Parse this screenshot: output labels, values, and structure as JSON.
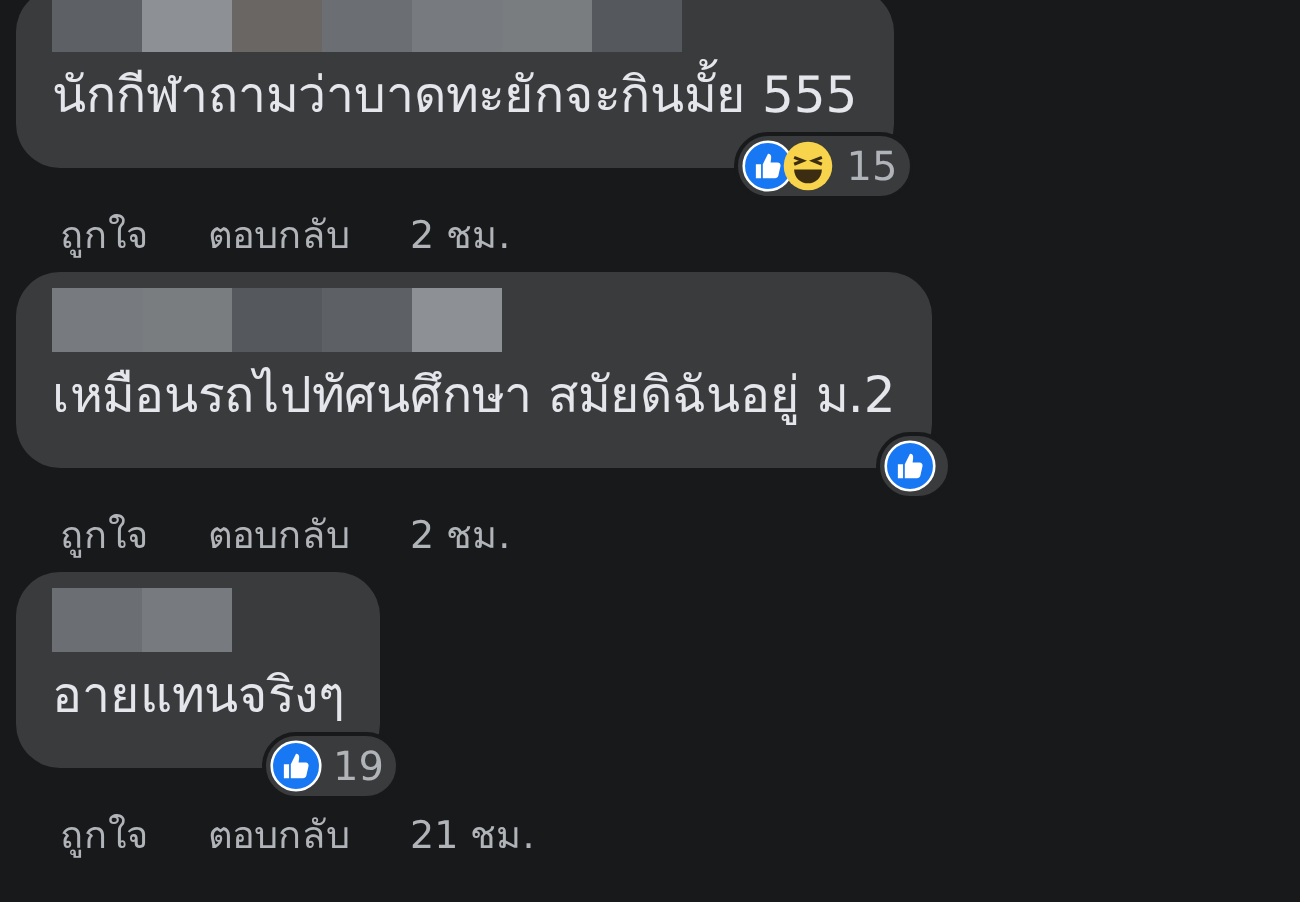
{
  "comments": [
    {
      "text": "นักกีฬาถามว่าบาดทะยักจะกินมั้ย 555",
      "reactions": [
        {
          "kind": "like"
        },
        {
          "kind": "haha"
        }
      ],
      "count": "15",
      "actions": [
        "ถูกใจ",
        "ตอบกลับ"
      ],
      "time": "2 ชม."
    },
    {
      "text": "เหมือนรถไปทัศนศึกษา สมัยดิฉันอยู่ ม.2",
      "reactions": [
        {
          "kind": "like"
        }
      ],
      "actions": [
        "ถูกใจ",
        "ตอบกลับ"
      ],
      "time": "2 ชม."
    },
    {
      "text": "อายแทนจริงๆ",
      "reactions": [
        {
          "kind": "like"
        }
      ],
      "count": "19",
      "actions": [
        "ถูกใจ",
        "ตอบกลับ"
      ],
      "time": "21 ชม."
    }
  ]
}
